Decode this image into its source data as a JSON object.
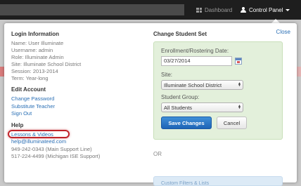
{
  "nav": {
    "dashboard_label": "Dashboard",
    "control_panel_label": "Control Panel"
  },
  "left": {
    "login_title": "Login Information",
    "info_lines": [
      "Name: User Illuminate",
      "Username: admin",
      "Role: Illuminate Admin",
      "Site: Illuminate School District",
      "Session: 2013-2014",
      "Term: Year-long"
    ],
    "edit_title": "Edit Account",
    "edit_links": [
      "Change Password",
      "Substitute Teacher",
      "Sign Out"
    ],
    "help_title": "Help",
    "help_links": [
      "Lessons & Videos",
      "help@illuminateed.com"
    ],
    "support_lines": [
      "949-242-0343 (Main Support Line)",
      "517-224-4499 (Michigan ISE Support)"
    ]
  },
  "right": {
    "title": "Change Student Set",
    "close_label": "Close",
    "enrollment_label": "Enrollment/Rostering Date:",
    "date_value": "03/27/2014",
    "site_label": "Site:",
    "site_value": "Illuminate School District",
    "group_label": "Student Group:",
    "group_value": "All Students",
    "save_label": "Save Changes",
    "cancel_label": "Cancel",
    "or_label": "OR",
    "blue_box_text": "Custom Filters & Lists"
  },
  "colors": {
    "highlight": "#c0242a",
    "link": "#2a6fb5",
    "primary_button": "#1e64b6",
    "green_panel": "#e3f0db"
  }
}
